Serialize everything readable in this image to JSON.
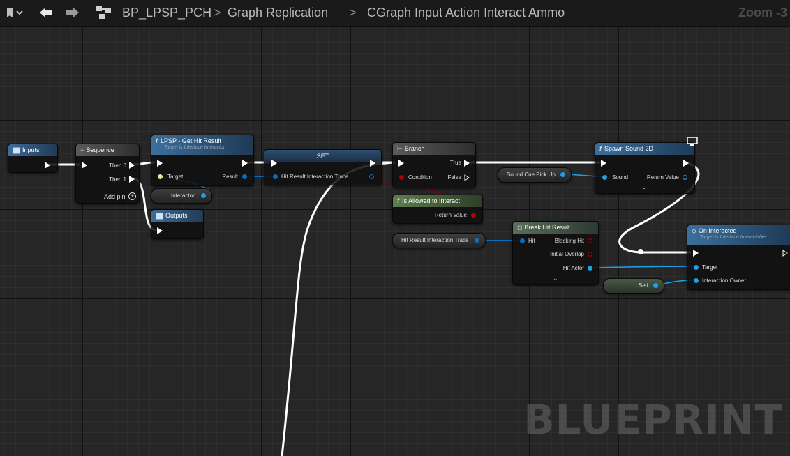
{
  "toolbar": {
    "bookmark_icon": "bookmark-icon",
    "back_icon": "arrow-left-icon",
    "forward_icon": "arrow-right-icon",
    "graph_icon": "graph-icon"
  },
  "breadcrumb": {
    "item1": "BP_LPSP_PCH",
    "sep1": ">",
    "item2": "Graph Replication",
    "sep2": ">",
    "item3": "CGraph Input Action Interact Ammo"
  },
  "zoom": "Zoom -3",
  "watermark": "BLUEPRINT",
  "nodes": {
    "inputs": {
      "title": "Inputs"
    },
    "sequence": {
      "title": "Sequence",
      "then0": "Then 0",
      "then1": "Then 1",
      "add_pin": "Add pin"
    },
    "get_hit_result": {
      "title": "LPSP - Get Hit Result",
      "subtitle": "Target is Interface Interactor",
      "target": "Target",
      "result": "Result"
    },
    "interactor": {
      "label": "Interactor"
    },
    "outputs": {
      "title": "Outputs"
    },
    "set": {
      "title": "SET",
      "var": "Hit Result Interaction Trace"
    },
    "branch": {
      "title": "Branch",
      "true": "True",
      "condition": "Condition",
      "false": "False"
    },
    "is_allowed": {
      "title": "Is Allowed to Interact",
      "return": "Return Value"
    },
    "hit_result_get": {
      "label": "Hit Result Interaction Trace"
    },
    "break_hit": {
      "title": "Break Hit Result",
      "hit": "Hit",
      "blocking": "Blocking Hit",
      "initial": "Initial Overlap",
      "actor": "Hit Actor"
    },
    "sound_cue": {
      "label": "Sound Cue Pick Up"
    },
    "spawn_sound": {
      "title": "Spawn Sound 2D",
      "sound": "Sound",
      "return": "Return Value"
    },
    "on_interacted": {
      "title": "On Interacted",
      "subtitle": "Target is Interface Interactable",
      "target": "Target",
      "owner": "Interaction Owner"
    },
    "self": {
      "label": "Self"
    }
  },
  "colors": {
    "exec_wire": "#ffffff",
    "struct_wire": "#0a6ebd",
    "object_wire": "#1fa3ff",
    "bool_wire": "#8c0000",
    "object_pin": "#1ea0e8",
    "bool_pin": "#b00000"
  }
}
